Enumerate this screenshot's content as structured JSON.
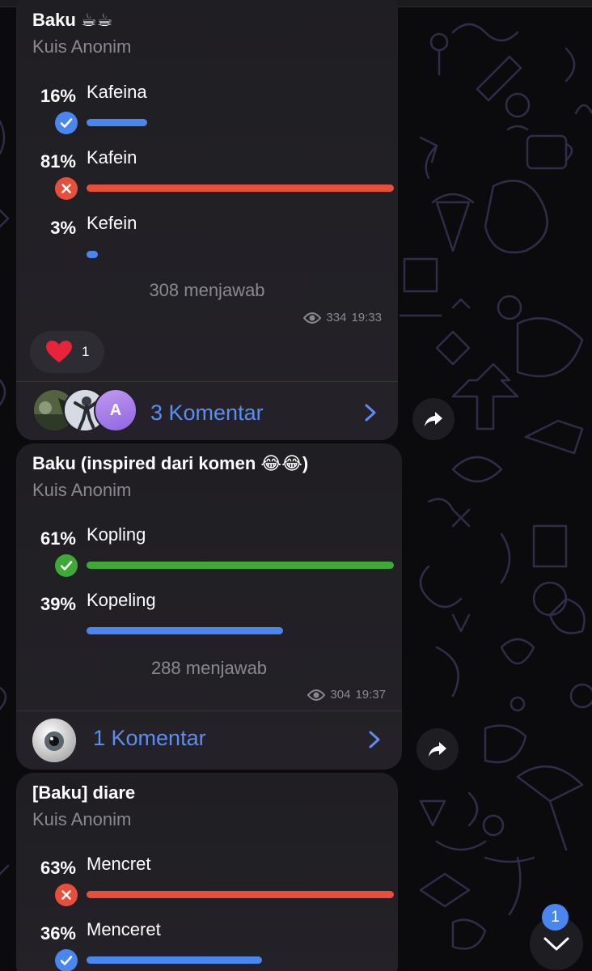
{
  "colors": {
    "background": "#0b0b0d",
    "bubble": "#222026",
    "accent": "#5b8ef0",
    "correct": "#3fa836",
    "wrong": "#e74f3a",
    "muted": "#8a8990"
  },
  "polls": [
    {
      "title": "Baku ☕☕",
      "subtitle": "Kuis Anonim",
      "options": [
        {
          "percent": "16%",
          "label": "Kafeina",
          "fraction": 0.16,
          "status": "chosen-correct",
          "color": "#4a86f0",
          "icon": "check-icon"
        },
        {
          "percent": "81%",
          "label": "Kafein",
          "fraction": 0.81,
          "status": "chosen-wrong",
          "color": "#e74f3a",
          "icon": "close-icon"
        },
        {
          "percent": "3%",
          "label": "Kefein",
          "fraction": 0.03,
          "status": "none",
          "color": "#4a86f0",
          "icon": ""
        }
      ],
      "answers": "308 menjawab",
      "views": "334",
      "time": "19:33",
      "reaction": {
        "emoji": "heart-icon",
        "count": "1"
      },
      "comments": "3 Komentar",
      "avatar_letter": "A"
    },
    {
      "title": "Baku (inspired dari komen 😂😂)",
      "subtitle": "Kuis Anonim",
      "options": [
        {
          "percent": "61%",
          "label": "Kopling",
          "fraction": 0.61,
          "status": "correct",
          "color": "#3fa836",
          "icon": "check-icon"
        },
        {
          "percent": "39%",
          "label": "Kopeling",
          "fraction": 0.39,
          "status": "none",
          "color": "#4a86f0",
          "icon": ""
        }
      ],
      "answers": "288 menjawab",
      "views": "304",
      "time": "19:37",
      "comments": "1 Komentar"
    },
    {
      "title": "[Baku] diare",
      "subtitle": "Kuis Anonim",
      "options": [
        {
          "percent": "63%",
          "label": "Mencret",
          "fraction": 0.63,
          "status": "chosen-wrong",
          "color": "#e74f3a",
          "icon": "close-icon"
        },
        {
          "percent": "36%",
          "label": "Menceret",
          "fraction": 0.36,
          "status": "chosen-correct",
          "color": "#4a86f0",
          "icon": "check-icon"
        }
      ]
    }
  ],
  "scroll_down": {
    "unread_count": "1",
    "icon": "chevron-down-icon"
  }
}
